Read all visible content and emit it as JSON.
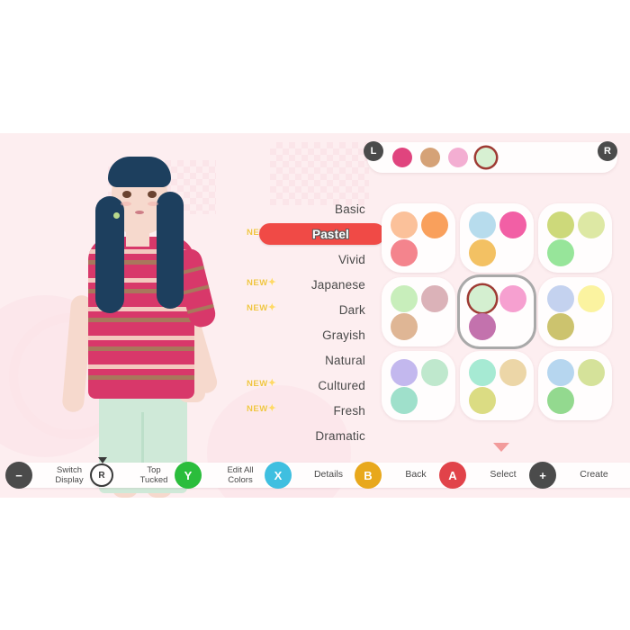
{
  "screen": {
    "background_color": "#fdeef0"
  },
  "palette_bar": {
    "left_shoulder": "L",
    "right_shoulder": "R",
    "swatches": [
      {
        "name": "deep-pink",
        "color": "#e0447e",
        "selected": false
      },
      {
        "name": "tan",
        "color": "#d5a277",
        "selected": false
      },
      {
        "name": "light-pink",
        "color": "#f3aed2",
        "selected": false
      },
      {
        "name": "mint",
        "color": "#d7f0d2",
        "selected": true
      }
    ]
  },
  "categories": [
    {
      "label": "Basic",
      "new": false,
      "selected": false
    },
    {
      "label": "Pastel",
      "new": true,
      "selected": true
    },
    {
      "label": "Vivid",
      "new": false,
      "selected": false
    },
    {
      "label": "Japanese",
      "new": true,
      "selected": false
    },
    {
      "label": "Dark",
      "new": true,
      "selected": false
    },
    {
      "label": "Grayish",
      "new": false,
      "selected": false
    },
    {
      "label": "Natural",
      "new": false,
      "selected": false
    },
    {
      "label": "Cultured",
      "new": true,
      "selected": false
    },
    {
      "label": "Fresh",
      "new": true,
      "selected": false
    },
    {
      "label": "Dramatic",
      "new": false,
      "selected": false
    }
  ],
  "new_badge": {
    "text": "NEW",
    "sparkle": "✦",
    "color": "#f0c440"
  },
  "selected_pill_color": "#f04a46",
  "color_cards": [
    {
      "index": 0,
      "selected": false,
      "dots": [
        {
          "color": "#fbc19a",
          "ring": false
        },
        {
          "color": "#f9a05c",
          "ring": false
        },
        {
          "color": "#f4848d",
          "ring": false
        }
      ]
    },
    {
      "index": 1,
      "selected": false,
      "dots": [
        {
          "color": "#b7dced",
          "ring": false
        },
        {
          "color": "#f25fa5",
          "ring": false
        },
        {
          "color": "#f3c163",
          "ring": false
        }
      ]
    },
    {
      "index": 2,
      "selected": false,
      "dots": [
        {
          "color": "#cdd97a",
          "ring": false
        },
        {
          "color": "#dde8a4",
          "ring": false
        },
        {
          "color": "#97e59a",
          "ring": false
        }
      ]
    },
    {
      "index": 3,
      "selected": false,
      "dots": [
        {
          "color": "#c8eebb",
          "ring": false
        },
        {
          "color": "#dbb2b8",
          "ring": false
        },
        {
          "color": "#dfb695",
          "ring": false
        }
      ]
    },
    {
      "index": 4,
      "selected": true,
      "dots": [
        {
          "color": "#d4efd0",
          "ring": true
        },
        {
          "color": "#f6a0d0",
          "ring": false
        },
        {
          "color": "#c372ad",
          "ring": false
        }
      ]
    },
    {
      "index": 5,
      "selected": false,
      "dots": [
        {
          "color": "#c4d2ef",
          "ring": false
        },
        {
          "color": "#fbf3a0",
          "ring": false
        },
        {
          "color": "#ccc36e",
          "ring": false
        }
      ]
    },
    {
      "index": 6,
      "selected": false,
      "dots": [
        {
          "color": "#c3b8ee",
          "ring": false
        },
        {
          "color": "#bfe8cd",
          "ring": false
        },
        {
          "color": "#9fe0cb",
          "ring": false
        }
      ]
    },
    {
      "index": 7,
      "selected": false,
      "dots": [
        {
          "color": "#a6ead3",
          "ring": false
        },
        {
          "color": "#ecd6a7",
          "ring": false
        },
        {
          "color": "#dbdc83",
          "ring": false
        }
      ]
    },
    {
      "index": 8,
      "selected": false,
      "dots": [
        {
          "color": "#b6d6ef",
          "ring": false
        },
        {
          "color": "#d5e29a",
          "ring": false
        },
        {
          "color": "#93d98f",
          "ring": false
        }
      ]
    }
  ],
  "scroll_indicator": {
    "direction": "down",
    "color": "#f08c8c"
  },
  "buttons": [
    {
      "glyph": "−",
      "glyph_class": "g-minus",
      "line1": "Switch",
      "line2": "Display",
      "name": "switch-display"
    },
    {
      "glyph": "R",
      "glyph_class": "g-r",
      "line1": "Top",
      "line2": "Tucked",
      "name": "top-tucked"
    },
    {
      "glyph": "Y",
      "glyph_class": "g-y",
      "line1": "Edit All",
      "line2": "Colors",
      "name": "edit-all-colors"
    },
    {
      "glyph": "X",
      "glyph_class": "g-x",
      "line1": "Details",
      "line2": "",
      "name": "details"
    },
    {
      "glyph": "B",
      "glyph_class": "g-b",
      "line1": "Back",
      "line2": "",
      "name": "back"
    },
    {
      "glyph": "A",
      "glyph_class": "g-a",
      "line1": "Select",
      "line2": "",
      "name": "select"
    },
    {
      "glyph": "+",
      "glyph_class": "g-plus",
      "line1": "Create",
      "line2": "",
      "name": "create"
    }
  ]
}
